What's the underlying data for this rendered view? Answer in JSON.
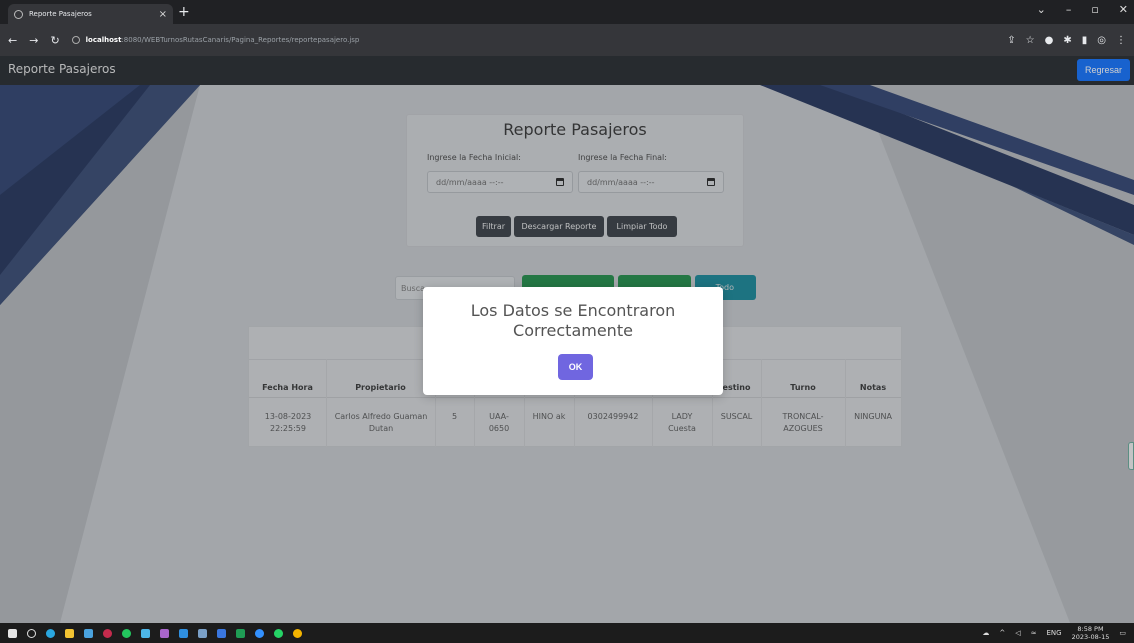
{
  "browser": {
    "tab_title": "Reporte Pasajeros",
    "tab_close": "×",
    "new_tab": "+",
    "url_host": "localhost",
    "url_path": ":8080/WEBTurnosRutasCanaris/Pagina_Reportes/reportepasajero.jsp"
  },
  "app": {
    "brand": "Reporte Pasajeros",
    "back_button": "Regresar"
  },
  "filter_card": {
    "title": "Reporte Pasajeros",
    "start_label": "Ingrese la Fecha Inicial:",
    "end_label": "Ingrese la Fecha Final:",
    "start_value": "dd/mm/aaaa --:--",
    "end_value": "dd/mm/aaaa --:--",
    "filter_button": "Filtrar",
    "download_button": "Descargar Reporte",
    "clear_button": "Limpiar Todo"
  },
  "search": {
    "placeholder": "Busca",
    "todo_button": "Todo"
  },
  "table": {
    "headers": [
      "Fecha Hora",
      "Propietario",
      "",
      "",
      "",
      "",
      "",
      "estino",
      "Turno",
      "Notas"
    ],
    "row": {
      "fecha": "13-08-2023 22:25:59",
      "propietario": "Carlos Alfredo Guaman Dutan",
      "num": "5",
      "placa": "UAA-0650",
      "conductor": "HINO ak",
      "cedula": "0302499942",
      "ayudante": "LADY Cuesta",
      "destino": "SUSCAL",
      "turno": "TRONCAL-AZOGUES",
      "notas": "NINGUNA"
    }
  },
  "modal": {
    "message": "Los Datos se Encontraron Correctamente",
    "ok_button": "OK"
  },
  "taskbar": {
    "lang": "ENG",
    "time": "8:58 PM",
    "date": "2023-08-15"
  }
}
